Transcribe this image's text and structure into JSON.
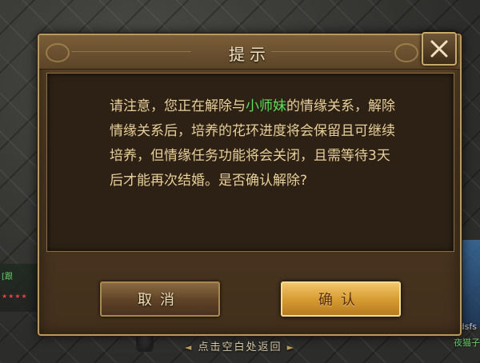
{
  "dialog": {
    "title": "提示",
    "message": {
      "before": "请注意，您正在解除与",
      "highlight": "小师妹",
      "after": "的情缘关系，解除情缘关系后，培养的花环进度将会保留且可继续培养，但情缘任务功能将会关闭，且需等待3天后才能再次结婚。是否确认解除?"
    },
    "cancel_label": "取消",
    "confirm_label": "确认",
    "close_icon": "close-icon"
  },
  "hint": {
    "text": "点击空白处返回",
    "left_arrow": "◄",
    "right_arrow": "►"
  },
  "background": {
    "left_text": "[跟",
    "left_stars": "★★★★",
    "right_text": "dsfs",
    "right_name": "夜猫子"
  },
  "colors": {
    "highlight": "#5ae05a",
    "message_text": "#e8cf9a",
    "confirm_button": "#d89c34",
    "cancel_button": "#5e4226"
  }
}
